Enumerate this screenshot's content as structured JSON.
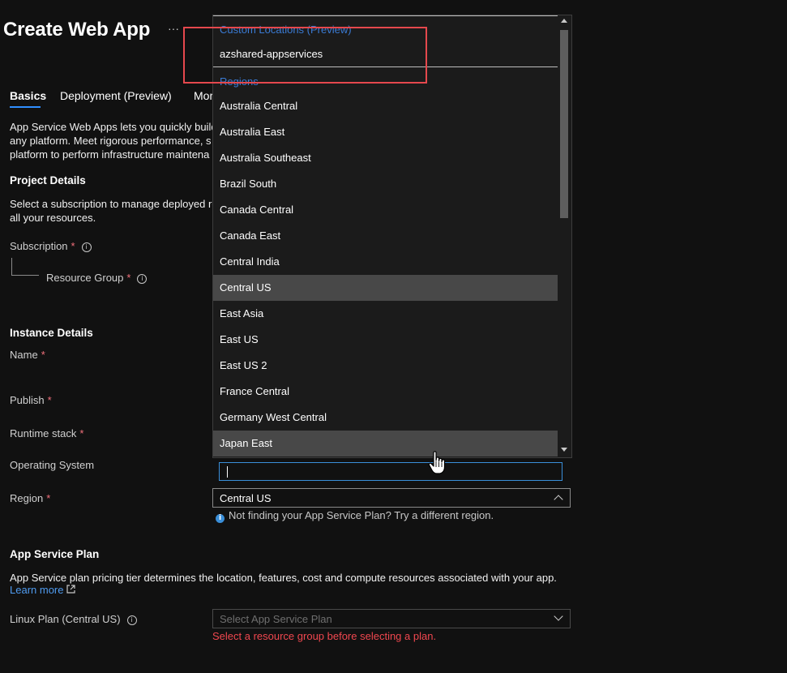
{
  "header": {
    "title": "Create Web App",
    "more_label": "···"
  },
  "tabs": [
    {
      "label": "Basics"
    },
    {
      "label": "Deployment (Preview)"
    },
    {
      "label": "Mor"
    }
  ],
  "intro": {
    "line1": "App Service Web Apps lets you quickly build",
    "line2": "any platform. Meet rigorous performance, s",
    "line3": "platform to perform infrastructure maintena"
  },
  "project": {
    "heading": "Project Details",
    "desc1": "Select a subscription to manage deployed re",
    "desc2": "all your resources.",
    "subscription_label": "Subscription",
    "resource_group_label": "Resource Group",
    "required_mark": "*"
  },
  "instance": {
    "heading": "Instance Details",
    "name_label": "Name",
    "publish_label": "Publish",
    "runtime_label": "Runtime stack",
    "os_label": "Operating System",
    "region_label": "Region"
  },
  "region_dropdown": {
    "custom_locations_header": "Custom Locations (Preview)",
    "custom_locations": [
      "azshared-appservices"
    ],
    "regions_header": "Regions",
    "regions": [
      "Australia Central",
      "Australia East",
      "Australia Southeast",
      "Brazil South",
      "Canada Central",
      "Canada East",
      "Central India",
      "Central US",
      "East Asia",
      "East US",
      "East US 2",
      "France Central",
      "Germany West Central",
      "Japan East"
    ],
    "highlighted": [
      "Central US",
      "Japan East"
    ],
    "filter_value": "",
    "selected_value": "Central US",
    "hint_text": "Not finding your App Service Plan? Try a different region."
  },
  "app_service_plan": {
    "heading": "App Service Plan",
    "desc": "App Service plan pricing tier determines the location, features, cost and compute resources associated with your app.",
    "learn_more": "Learn more",
    "linux_plan_label": "Linux Plan (Central US)",
    "select_placeholder": "Select App Service Plan",
    "error": "Select a resource group before selecting a plan."
  },
  "colors": {
    "background": "#111111",
    "accent": "#2f8fff",
    "required": "#f1707b",
    "error": "#f0474f",
    "highlight_box": "#e5484d"
  },
  "icons": [
    "info-icon",
    "external-link-icon",
    "chevron-up-icon",
    "chevron-down-icon",
    "hand-pointer-icon"
  ]
}
